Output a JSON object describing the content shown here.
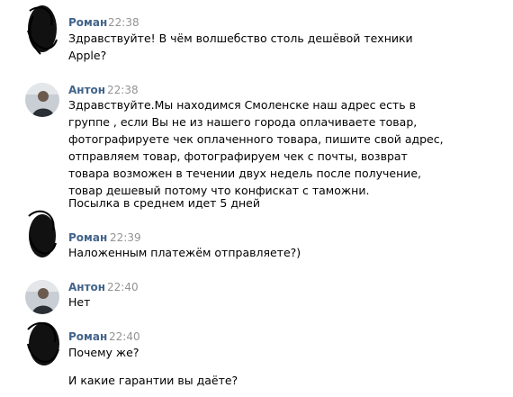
{
  "messages": [
    {
      "sender": "Роман",
      "time": "22:38",
      "avatar": "scribbled-avatar",
      "lines": [
        "Здравствуйте! В чём волшебство столь дешёвой техники",
        "Apple?"
      ]
    },
    {
      "sender": "Антон",
      "time": "22:38",
      "avatar": "photo-avatar",
      "lines": [
        "Здравствуйте.Мы находимся Смоленске наш адрес есть в",
        "группе , если Вы не из нашего города оплачиваете товар,",
        "фотографируете чек оплаченного товара, пишите свой адрес,",
        "отправляем товар, фотографируем чек с почты, возврат",
        "товара возможен в течении двух недель после получение,",
        "товар дешевый потому что конфискат с таможни.",
        "Посылка в среднем идет 5 дней"
      ]
    },
    {
      "sender": "Роман",
      "time": "22:39",
      "avatar": "scribbled-avatar",
      "lines": [
        "Наложенным платежём отправляете?)"
      ]
    },
    {
      "sender": "Антон",
      "time": "22:40",
      "avatar": "photo-avatar",
      "lines": [
        "Нет"
      ]
    },
    {
      "sender": "Роман",
      "time": "22:40",
      "avatar": "scribbled-avatar",
      "lines": [
        "Почему же?",
        "",
        "И какие гарантии вы даёте?"
      ]
    }
  ],
  "colors": {
    "sender_name": "#42648b",
    "timestamp": "#939393",
    "text": "#000000"
  }
}
